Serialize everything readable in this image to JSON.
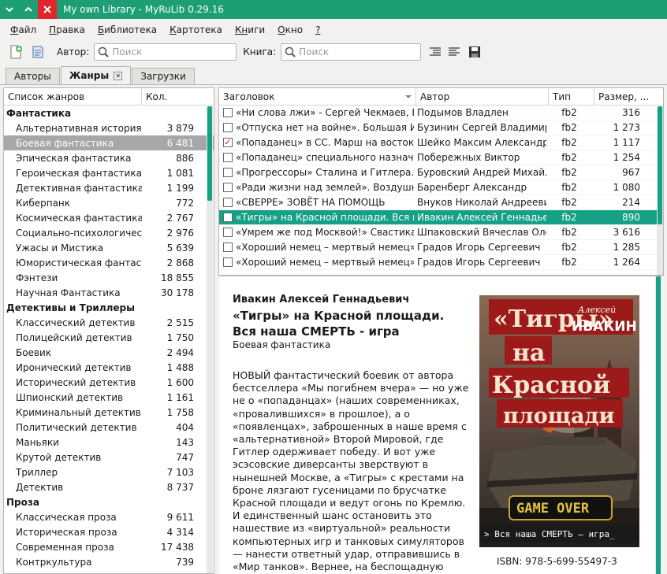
{
  "window": {
    "title": "My own Library - MyRuLib 0.29.16"
  },
  "menu": [
    {
      "label": "Файл",
      "u": "Ф",
      "rest": "айл"
    },
    {
      "label": "Правка",
      "u": "П",
      "rest": "равка"
    },
    {
      "label": "Библиотека",
      "u": "Б",
      "rest": "иблиотека"
    },
    {
      "label": "Картотека",
      "u": "К",
      "rest": "артотека"
    },
    {
      "label": "Книги",
      "u": "Кн",
      "rest": "иги"
    },
    {
      "label": "Окно",
      "u": "О",
      "rest": "кно"
    },
    {
      "label": "?",
      "u": "?",
      "rest": ""
    }
  ],
  "toolbar": {
    "author_label": "Автор:",
    "author_placeholder": "Поиск",
    "book_label": "Книга:",
    "book_placeholder": "Поиск"
  },
  "tabs": [
    {
      "label": "Авторы"
    },
    {
      "label": "Жанры"
    },
    {
      "label": "Загрузки"
    }
  ],
  "genres": {
    "col_name": "Список жанров",
    "col_count": "Кол.",
    "rows": [
      {
        "name": "Фантастика",
        "count": "",
        "cat": true
      },
      {
        "name": "Альтернативная история",
        "count": "3 879"
      },
      {
        "name": "Боевая фантастика",
        "count": "6 481",
        "selected": true
      },
      {
        "name": "Эпическая фантастика",
        "count": "886"
      },
      {
        "name": "Героическая фантастика",
        "count": "1 081"
      },
      {
        "name": "Детективная фантастика",
        "count": "1 199"
      },
      {
        "name": "Киберпанк",
        "count": "772"
      },
      {
        "name": "Космическая фантастика",
        "count": "2 767"
      },
      {
        "name": "Социально-психологическая",
        "count": "2 976"
      },
      {
        "name": "Ужасы и Мистика",
        "count": "5 639"
      },
      {
        "name": "Юмористическая фантастика",
        "count": "2 868"
      },
      {
        "name": "Фэнтези",
        "count": "18 855"
      },
      {
        "name": "Научная Фантастика",
        "count": "30 178"
      },
      {
        "name": "Детективы и Триллеры",
        "count": "",
        "cat": true
      },
      {
        "name": "Классический детектив",
        "count": "2 515"
      },
      {
        "name": "Полицейский детектив",
        "count": "1 750"
      },
      {
        "name": "Боевик",
        "count": "2 494"
      },
      {
        "name": "Иронический детектив",
        "count": "1 488"
      },
      {
        "name": "Исторический детектив",
        "count": "1 600"
      },
      {
        "name": "Шпионский детектив",
        "count": "1 161"
      },
      {
        "name": "Криминальный детектив",
        "count": "1 758"
      },
      {
        "name": "Политический детектив",
        "count": "404"
      },
      {
        "name": "Маньяки",
        "count": "143"
      },
      {
        "name": "Крутой детектив",
        "count": "747"
      },
      {
        "name": "Триллер",
        "count": "7 103"
      },
      {
        "name": "Детектив",
        "count": "8 737"
      },
      {
        "name": "Проза",
        "count": "",
        "cat": true
      },
      {
        "name": "Классическая проза",
        "count": "9 611"
      },
      {
        "name": "Историческая проза",
        "count": "4 314"
      },
      {
        "name": "Современная проза",
        "count": "17 438"
      },
      {
        "name": "Контркультура",
        "count": "739"
      }
    ]
  },
  "books": {
    "col_title": "Заголовок",
    "col_author": "Автор",
    "col_type": "Тип",
    "col_size": "Размер, ...",
    "rows": [
      {
        "title": "«Ни слова лжи» - Сергей Чекмаев, Влад",
        "author": "Подымов Владлен",
        "type": "fb2",
        "size": "316",
        "checked": false
      },
      {
        "title": "«Отпуска нет на войне». Большая Игра -",
        "author": "Бузинин Сергей Владимиро",
        "type": "fb2",
        "size": "1 273",
        "checked": false
      },
      {
        "title": "«Попаданец» в СС. Марш на восток",
        "author": "Шейко Максим Александро",
        "type": "fb2",
        "size": "1 117",
        "checked": true
      },
      {
        "title": "«Попаданец» специального назначения",
        "author": "Побережных Виктор",
        "type": "fb2",
        "size": "1 254",
        "checked": false
      },
      {
        "title": "«Прогрессоры» Сталина и Гитлера. Дае",
        "author": "Буровский Андрей Михайло",
        "type": "fb2",
        "size": "967",
        "checked": false
      },
      {
        "title": "«Ради жизни над землей». Воздушный а",
        "author": "Баренберг Александр",
        "type": "fb2",
        "size": "1 080",
        "checked": false
      },
      {
        "title": "«СВЕРРЕ» ЗОВЁТ НА ПОМОЩЬ",
        "author": "Внуков Николай Андреевич",
        "type": "fb2",
        "size": "214",
        "checked": false
      },
      {
        "title": "«Тигры» на Красной площади. Вся наша",
        "author": "Ивакин Алексей Геннадьеви",
        "type": "fb2",
        "size": "890",
        "checked": false,
        "selected": true
      },
      {
        "title": "«Умрем же под Москвой!» Свастика над",
        "author": "Шпаковский Вячеслав Олег",
        "type": "fb2",
        "size": "3 616",
        "checked": false
      },
      {
        "title": "«Хороший немец – мертвый немец». Чу",
        "author": "Градов Игорь Сергеевич",
        "type": "fb2",
        "size": "1 285",
        "checked": false
      },
      {
        "title": "«Хороший немец – мертвый немец». Чу",
        "author": "Градов Игорь Сергеевич",
        "type": "fb2",
        "size": "1 264",
        "checked": false
      }
    ]
  },
  "details": {
    "author": "Ивакин Алексей Геннадьевич",
    "title": "«Тигры» на Красной площади. Вся наша СМЕРТЬ - игра",
    "genre": "Боевая фантастика",
    "annotation": "НОВЫЙ фантастический боевик от автора бестселлера «Мы погибнем вчера» — но уже не о «попаданцах» (наших современниках, «провалившихся» в прошлое), а о «появленцах», заброшенных в наше время с «альтернативной» Второй Мировой, где Гитлер одерживает победу. И вот уже эсэсовские диверсанты зверствуют в нынешней Москве, а «Тигры» с крестами на броне лязгают гусеницами по брусчатке Красной площади и ведут огонь по Кремлю. И единственный шанс остановить это нашествие из «виртуальной» реальности компьютерных игр и танковых симуляторов — нанести ответный удар, отправившись в «Мир танков». Вернее, на беспощадную танковую войну, где",
    "isbn": "ISBN: 978-5-699-55497-3",
    "cover": {
      "title_1": "«Тигры»",
      "title_2": "на",
      "title_3": "Красной",
      "title_4": "площади",
      "author_1": "Алексей",
      "author_2": "ИВАКИН",
      "banner": "GAME OVER",
      "tagline": "> Вся наша СМЕРТЬ — игра_"
    }
  },
  "colors": {
    "accent": "#16a085",
    "titlebar": "#1d9e74",
    "close": "#e0262a"
  }
}
